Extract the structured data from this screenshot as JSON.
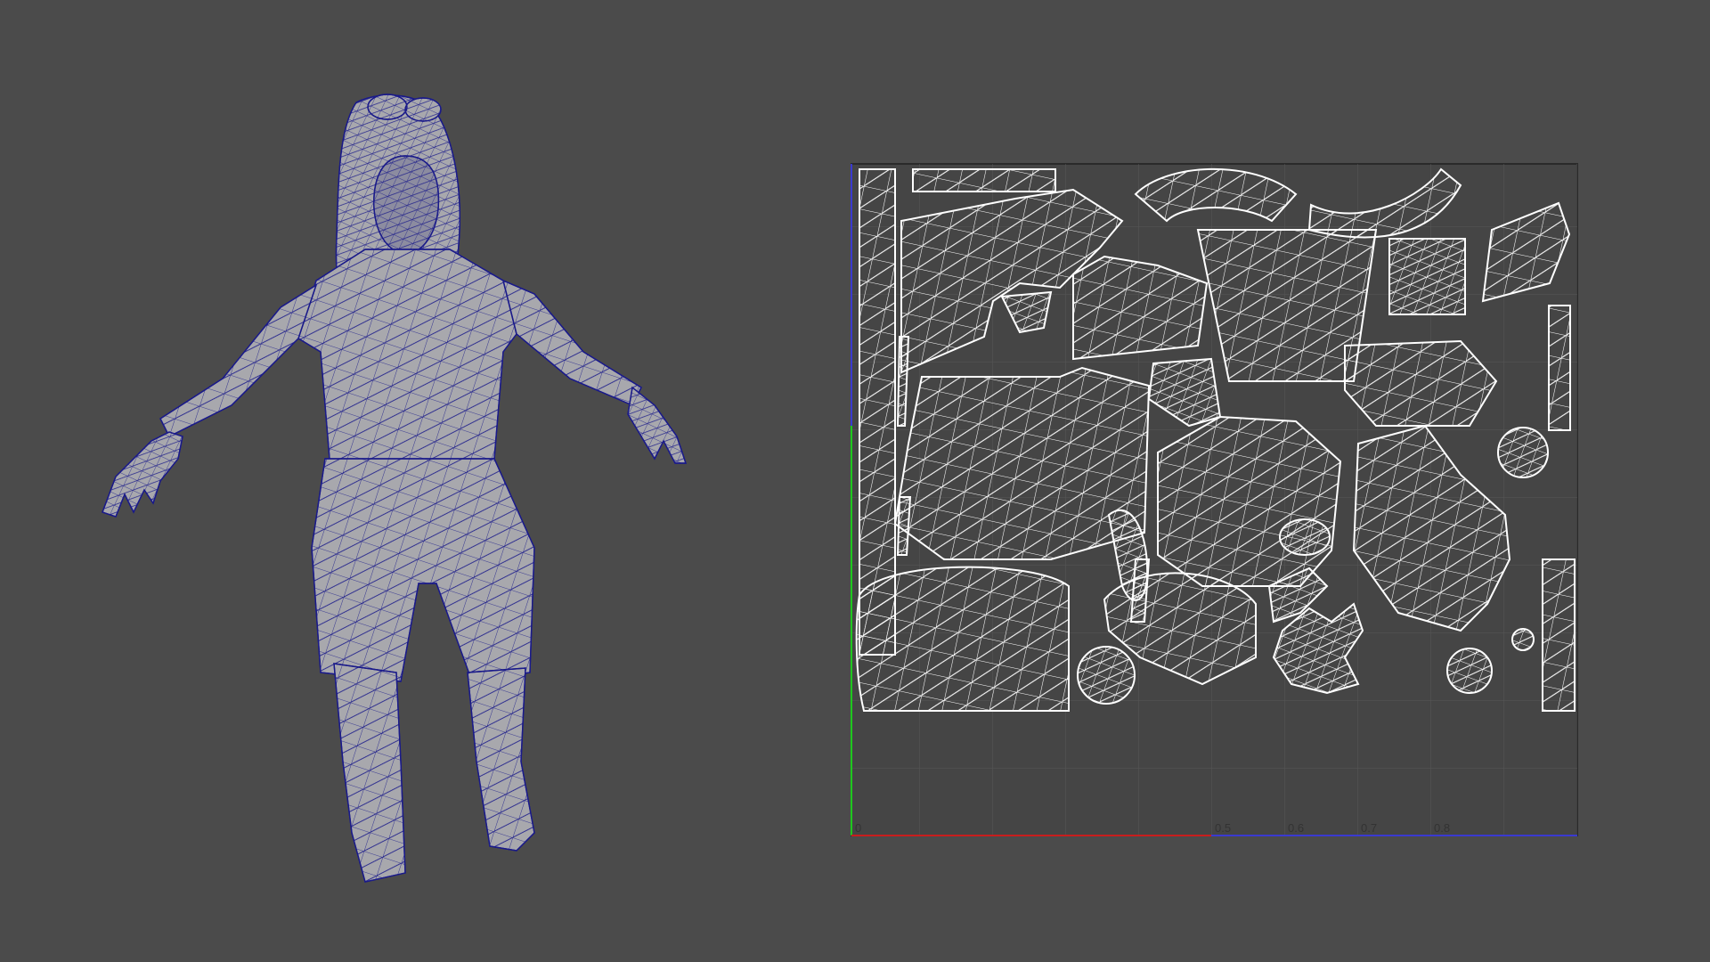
{
  "scene": {
    "background_color": "#4b4b4b",
    "mesh_fill_color": "#a8a8ad",
    "wire_color": "#1a1a8a",
    "uv_wire_color": "#ffffff",
    "uv_bg_color": "#454545",
    "uv_grid_color": "#565656",
    "u_axis_color": "#c81e1e",
    "v_axis_color": "#1ec81e",
    "frame_color": "#2a2a2a"
  },
  "model_viewport": {
    "subject": "character-wireframe-mesh"
  },
  "uv_editor": {
    "tick_labels": [
      "0",
      "0.5",
      "0.6",
      "0.7",
      "0.8"
    ]
  }
}
